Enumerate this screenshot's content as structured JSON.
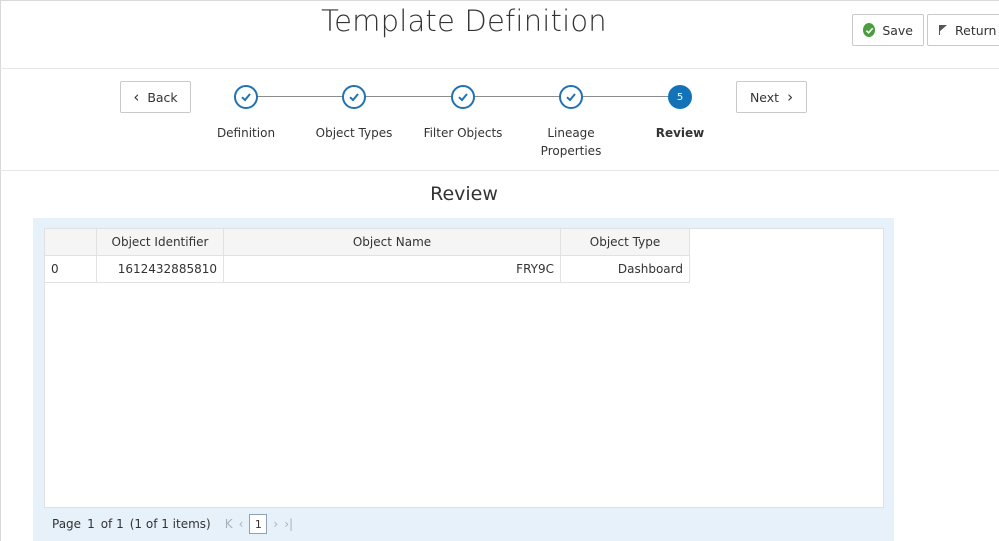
{
  "header": {
    "title": "Template Definition",
    "save_label": "Save",
    "return_label": "Return"
  },
  "train": {
    "back_label": "Back",
    "next_label": "Next",
    "current_step_number": "5",
    "steps": [
      {
        "label": "Definition",
        "state": "done"
      },
      {
        "label": "Object Types",
        "state": "done"
      },
      {
        "label": "Filter Objects",
        "state": "done"
      },
      {
        "label": "Lineage Properties",
        "state": "done"
      },
      {
        "label": "Review",
        "state": "current"
      }
    ]
  },
  "section": {
    "title": "Review"
  },
  "grid": {
    "columns": [
      "",
      "Object Identifier",
      "Object Name",
      "Object Type"
    ],
    "rows": [
      {
        "index": "0",
        "object_identifier": "1612432885810",
        "object_name": "FRY9C",
        "object_type": "Dashboard"
      }
    ]
  },
  "pager": {
    "page_text": "Page",
    "page_number": "1",
    "of_text": "of 1",
    "items_text": "(1 of 1 items)",
    "current_page": "1"
  },
  "colors": {
    "accent": "#1372b8",
    "save_icon": "#4a9e3e",
    "panel_bg": "#e7f1fa"
  }
}
